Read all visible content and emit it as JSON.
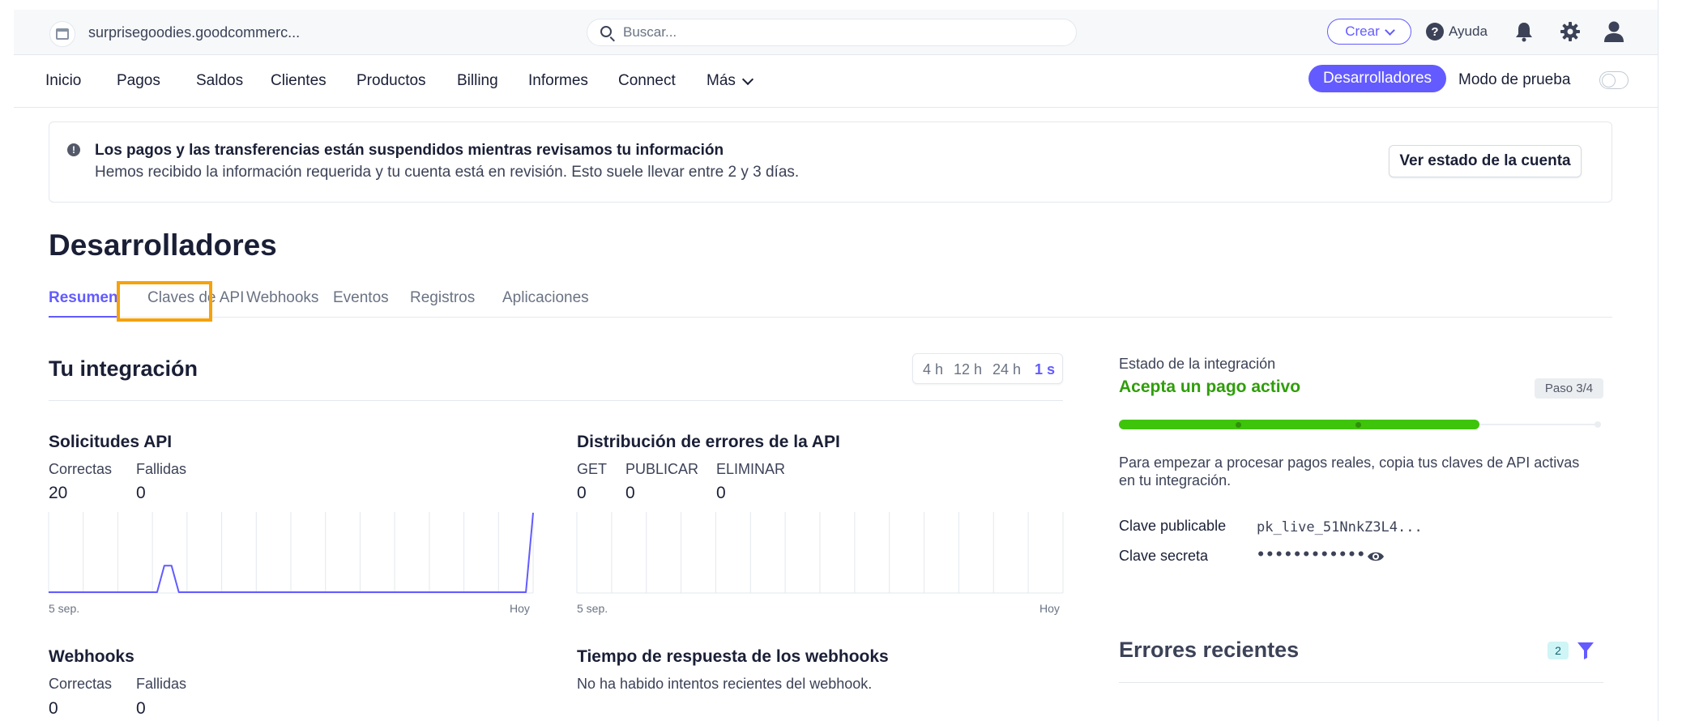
{
  "topbar": {
    "account_name": "surprisegoodies.goodcommerc...",
    "search_placeholder": "Buscar...",
    "create_label": "Crear",
    "help_label": "Ayuda"
  },
  "nav": {
    "items": [
      "Inicio",
      "Pagos",
      "Saldos",
      "Clientes",
      "Productos",
      "Billing",
      "Informes",
      "Connect",
      "Más"
    ],
    "developers_label": "Desarrolladores",
    "test_mode_label": "Modo de prueba"
  },
  "banner": {
    "title": "Los pagos y las transferencias están suspendidos mientras revisamos tu información",
    "subtitle": "Hemos recibido la información requerida y tu cuenta está en revisión. Esto suele llevar entre 2 y 3 días.",
    "button_label": "Ver estado de la cuenta"
  },
  "page": {
    "title": "Desarrolladores",
    "tabs": [
      "Resumen",
      "Claves de API",
      "Webhooks",
      "Eventos",
      "Registros",
      "Aplicaciones"
    ]
  },
  "integration": {
    "title": "Tu integración",
    "ranges": [
      "4 h",
      "12 h",
      "24 h",
      "1 s"
    ],
    "api_requests": {
      "title": "Solicitudes API",
      "labels": [
        "Correctas",
        "Fallidas"
      ],
      "values": [
        "20",
        "0"
      ],
      "x_start": "5 sep.",
      "x_end": "Hoy"
    },
    "api_errors": {
      "title": "Distribución de errores de la API",
      "labels": [
        "GET",
        "PUBLICAR",
        "ELIMINAR"
      ],
      "values": [
        "0",
        "0",
        "0"
      ],
      "x_start": "5 sep.",
      "x_end": "Hoy"
    },
    "webhooks": {
      "title": "Webhooks",
      "labels": [
        "Correctas",
        "Fallidas"
      ],
      "values": [
        "0",
        "0"
      ]
    },
    "webhook_response": {
      "title": "Tiempo de respuesta de los webhooks",
      "message": "No ha habido intentos recientes del webhook."
    }
  },
  "status": {
    "label": "Estado de la integración",
    "value": "Acepta un pago activo",
    "step": "Paso 3/4",
    "progress": 0.75,
    "description": "Para empezar a procesar pagos reales, copia tus claves de API activas en tu integración.",
    "publishable_key_label": "Clave publicable",
    "publishable_key_value": "pk_live_51NnkZ3L4...",
    "secret_key_label": "Clave secreta",
    "secret_key_value": "••••••••••••"
  },
  "recent_errors": {
    "title": "Errores recientes",
    "count": "2"
  },
  "colors": {
    "accent": "#635bff",
    "success": "#2f9e0a",
    "progress_fill": "#3ec40a",
    "highlight": "#f5a20a"
  },
  "chart_data": [
    {
      "type": "line",
      "series": [
        {
          "values": [
            0,
            0,
            0,
            0,
            0,
            0,
            0,
            0,
            0,
            0,
            0,
            0,
            0,
            0,
            0,
            0,
            1,
            1,
            0,
            0,
            0,
            0,
            0,
            0,
            0,
            0,
            0,
            0,
            0,
            0,
            0,
            0,
            0,
            0,
            0,
            0,
            0,
            0,
            0,
            0,
            0,
            0,
            0,
            0,
            0,
            0,
            0,
            0,
            0,
            0,
            0,
            0,
            0,
            0,
            0,
            0,
            0,
            0,
            0,
            0,
            0,
            0,
            0,
            0,
            0,
            0,
            0,
            3
          ]
        }
      ],
      "x_labels": [
        "5 sep.",
        "Hoy"
      ],
      "grid": true
    },
    {
      "type": "line",
      "series": [],
      "x_labels": [
        "5 sep.",
        "Hoy"
      ],
      "grid": true
    }
  ]
}
